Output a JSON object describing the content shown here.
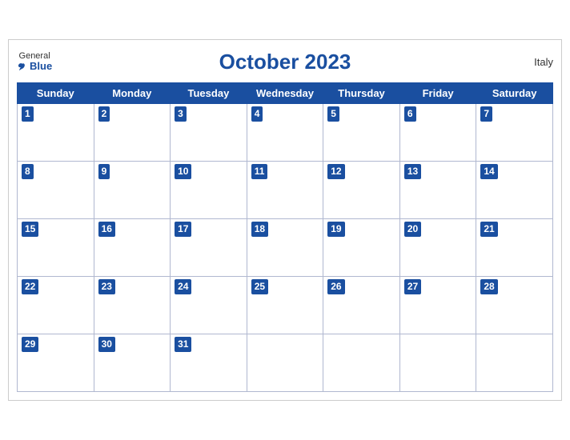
{
  "header": {
    "logo_general": "General",
    "logo_blue": "Blue",
    "title": "October 2023",
    "country": "Italy"
  },
  "weekdays": [
    "Sunday",
    "Monday",
    "Tuesday",
    "Wednesday",
    "Thursday",
    "Friday",
    "Saturday"
  ],
  "weeks": [
    [
      {
        "day": 1,
        "empty": false
      },
      {
        "day": 2,
        "empty": false
      },
      {
        "day": 3,
        "empty": false
      },
      {
        "day": 4,
        "empty": false
      },
      {
        "day": 5,
        "empty": false
      },
      {
        "day": 6,
        "empty": false
      },
      {
        "day": 7,
        "empty": false
      }
    ],
    [
      {
        "day": 8,
        "empty": false
      },
      {
        "day": 9,
        "empty": false
      },
      {
        "day": 10,
        "empty": false
      },
      {
        "day": 11,
        "empty": false
      },
      {
        "day": 12,
        "empty": false
      },
      {
        "day": 13,
        "empty": false
      },
      {
        "day": 14,
        "empty": false
      }
    ],
    [
      {
        "day": 15,
        "empty": false
      },
      {
        "day": 16,
        "empty": false
      },
      {
        "day": 17,
        "empty": false
      },
      {
        "day": 18,
        "empty": false
      },
      {
        "day": 19,
        "empty": false
      },
      {
        "day": 20,
        "empty": false
      },
      {
        "day": 21,
        "empty": false
      }
    ],
    [
      {
        "day": 22,
        "empty": false
      },
      {
        "day": 23,
        "empty": false
      },
      {
        "day": 24,
        "empty": false
      },
      {
        "day": 25,
        "empty": false
      },
      {
        "day": 26,
        "empty": false
      },
      {
        "day": 27,
        "empty": false
      },
      {
        "day": 28,
        "empty": false
      }
    ],
    [
      {
        "day": 29,
        "empty": false
      },
      {
        "day": 30,
        "empty": false
      },
      {
        "day": 31,
        "empty": false
      },
      {
        "day": null,
        "empty": true
      },
      {
        "day": null,
        "empty": true
      },
      {
        "day": null,
        "empty": true
      },
      {
        "day": null,
        "empty": true
      }
    ]
  ]
}
